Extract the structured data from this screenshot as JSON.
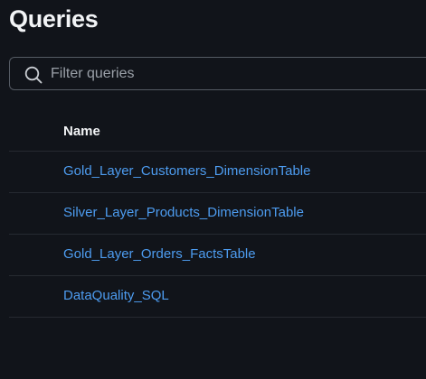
{
  "page": {
    "title": "Queries"
  },
  "filter": {
    "placeholder": "Filter queries",
    "value": ""
  },
  "table": {
    "columns": [
      "Name"
    ],
    "rows": [
      {
        "name": "Gold_Layer_Customers_DimensionTable"
      },
      {
        "name": "Silver_Layer_Products_DimensionTable"
      },
      {
        "name": "Gold_Layer_Orders_FactsTable"
      },
      {
        "name": "DataQuality_SQL"
      }
    ]
  },
  "colors": {
    "background": "#11141a",
    "link": "#4d9cf0",
    "border": "#545a63",
    "divider": "#262a31"
  },
  "icons": {
    "filter": "search-icon"
  }
}
